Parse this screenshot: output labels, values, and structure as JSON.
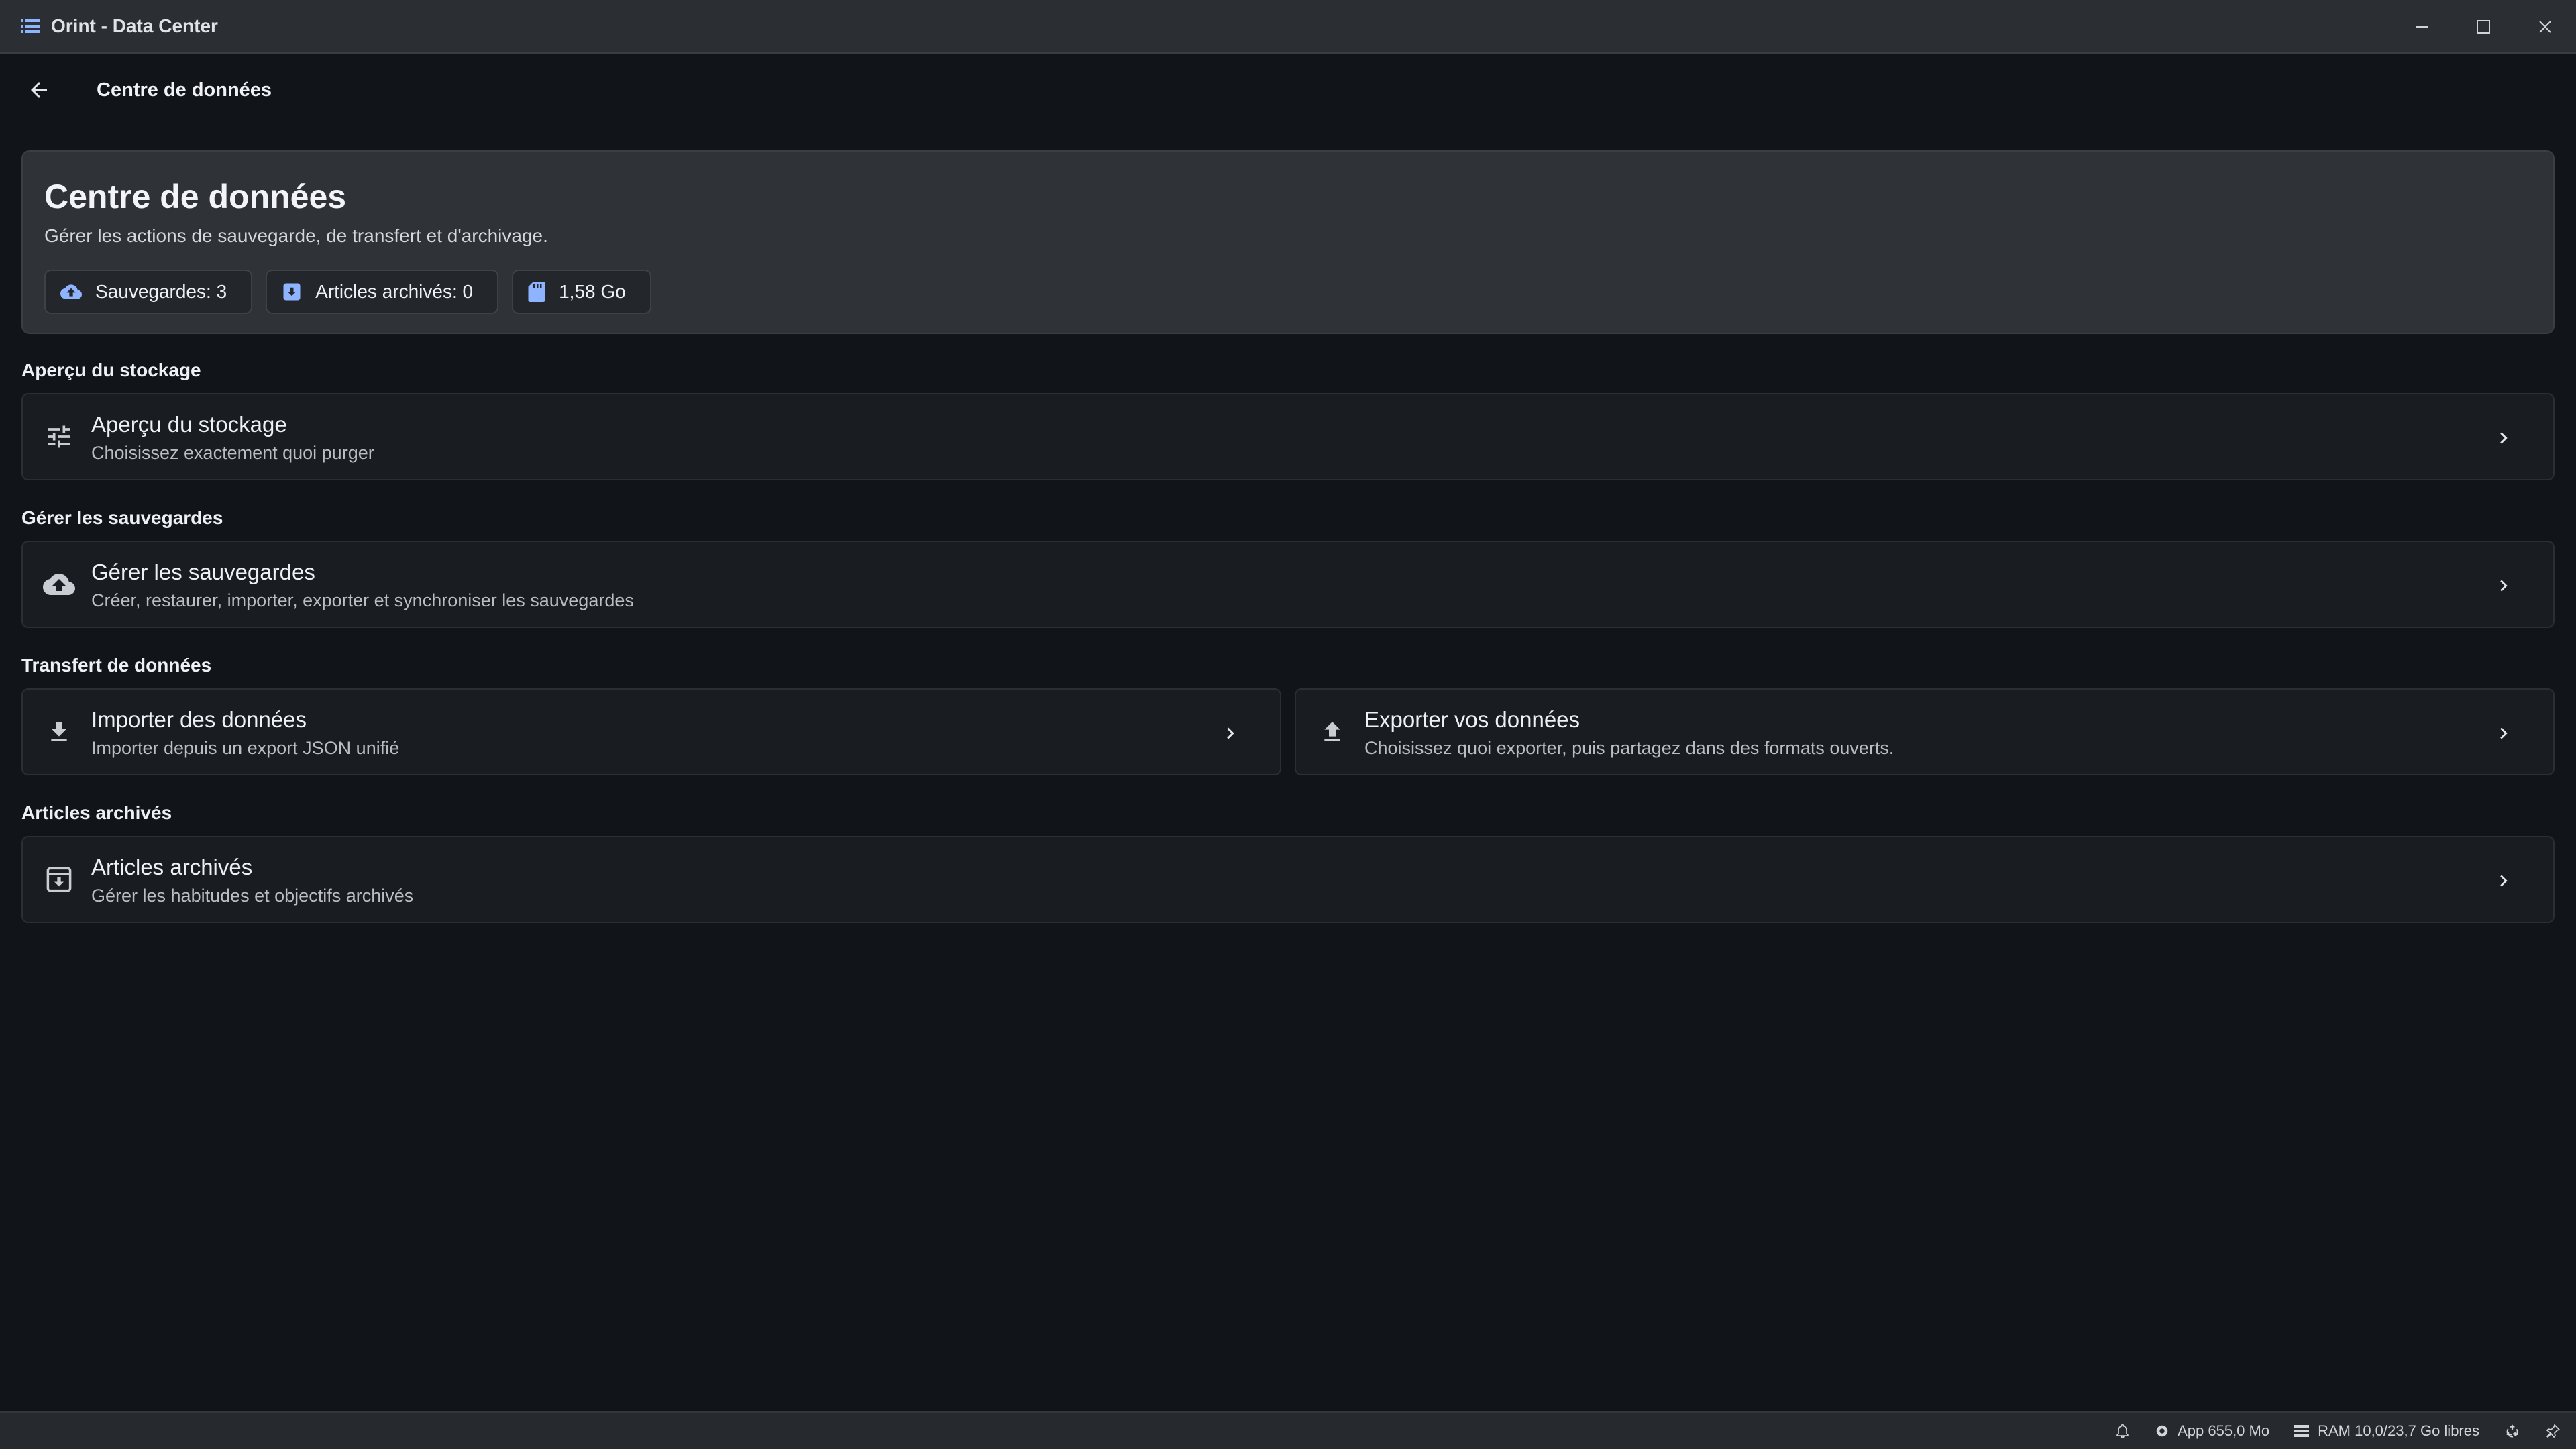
{
  "window": {
    "title": "Orint - Data Center",
    "icons": {
      "app": "list-icon",
      "minimize": "minimize-icon",
      "maximize": "maximize-icon",
      "close": "close-icon"
    }
  },
  "header": {
    "title": "Centre de données",
    "back_icon": "arrow-left-icon"
  },
  "hero": {
    "title": "Centre de données",
    "subtitle": "Gérer les actions de sauvegarde, de transfert et d'archivage.",
    "chips": [
      {
        "label": "Sauvegardes: 3",
        "icon": "cloud-upload-icon"
      },
      {
        "label": "Articles archivés: 0",
        "icon": "archive-icon"
      },
      {
        "label": "1,58 Go",
        "icon": "sd-card-icon"
      }
    ]
  },
  "sections": {
    "storage": {
      "label": "Aperçu du stockage",
      "card": {
        "title": "Aperçu du stockage",
        "subtitle": "Choisissez exactement quoi purger",
        "icon": "tune-icon"
      }
    },
    "backups": {
      "label": "Gérer les sauvegardes",
      "card": {
        "title": "Gérer les sauvegardes",
        "subtitle": "Créer, restaurer, importer, exporter et synchroniser les sauvegardes",
        "icon": "cloud-upload-icon"
      }
    },
    "transfer": {
      "label": "Transfert de données",
      "import": {
        "title": "Importer des données",
        "subtitle": "Importer depuis un export JSON unifié",
        "icon": "download-icon"
      },
      "export": {
        "title": "Exporter vos données",
        "subtitle": "Choisissez quoi exporter, puis partagez dans des formats ouverts.",
        "icon": "upload-icon"
      }
    },
    "archived": {
      "label": "Articles archivés",
      "card": {
        "title": "Articles archivés",
        "subtitle": "Gérer les habitudes et objectifs archivés",
        "icon": "archive-icon"
      }
    }
  },
  "statusbar": {
    "notifications_icon": "bell-icon",
    "app_memory": "App 655,0 Mo",
    "ram": "RAM 10,0/23,7 Go libres",
    "recycle_icon": "recycle-icon",
    "pin_icon": "pin-icon"
  },
  "colors": {
    "background": "#111419",
    "titlebar": "#2b2e33",
    "hero_card": "#2f3237",
    "card": "#191c21",
    "chip_icon_accent": "#8fb4ff"
  }
}
